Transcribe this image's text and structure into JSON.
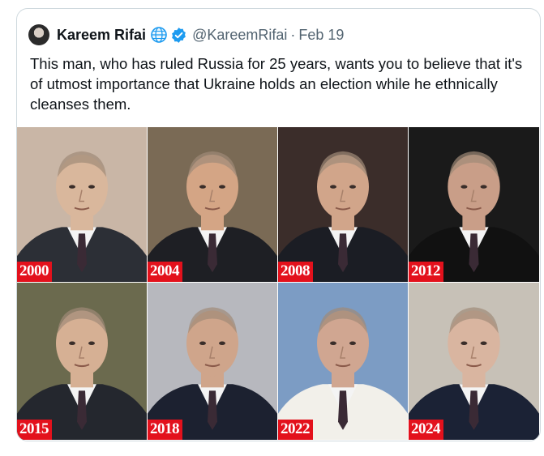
{
  "tweet": {
    "author_name": "Kareem Rifai",
    "author_handle": "@KareemRifai",
    "separator": "·",
    "date": "Feb 19",
    "text": "This man, who has ruled Russia for 25 years, wants you to believe that it's of utmost importance that Ukraine holds an election while he ethnically cleanses them."
  },
  "icons": {
    "avatar": "profile-avatar",
    "globe": "globe-icon",
    "verified": "verified-badge-icon"
  },
  "photos": [
    {
      "year": "2000",
      "bg": "#c9b6a6",
      "suit": "#2c2f36",
      "skin": "#d9b79c"
    },
    {
      "year": "2004",
      "bg": "#7a6a55",
      "suit": "#1e1f24",
      "skin": "#d4a585"
    },
    {
      "year": "2008",
      "bg": "#3b2d2a",
      "suit": "#1b1d24",
      "skin": "#d1a58a"
    },
    {
      "year": "2012",
      "bg": "#1a1a1a",
      "suit": "#111111",
      "skin": "#c99e88"
    },
    {
      "year": "2015",
      "bg": "#6b6a4e",
      "suit": "#24272e",
      "skin": "#d6b094"
    },
    {
      "year": "2018",
      "bg": "#b7b8be",
      "suit": "#1c2130",
      "skin": "#cfa58b"
    },
    {
      "year": "2022",
      "bg": "#7c9cc4",
      "suit": "#f2f0ea",
      "skin": "#d0a691"
    },
    {
      "year": "2024",
      "bg": "#c7c1b7",
      "suit": "#1b2235",
      "skin": "#d9b5a0"
    }
  ],
  "colors": {
    "year_label_bg": "#e3111c",
    "verified_blue": "#1d9bf0",
    "secondary_text": "#536471"
  }
}
